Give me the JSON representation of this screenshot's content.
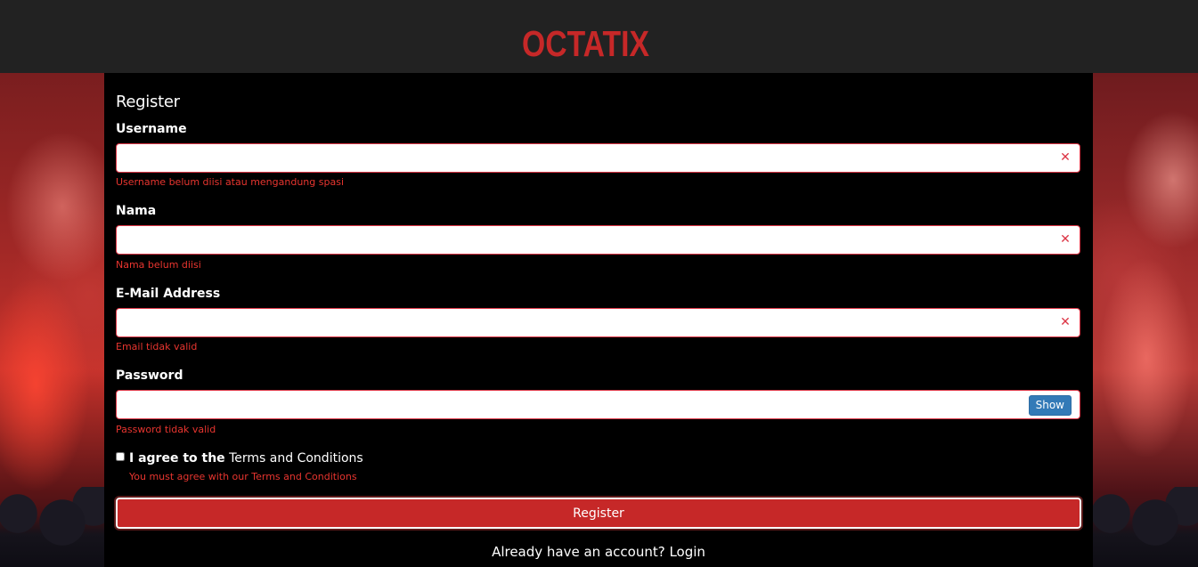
{
  "header": {
    "logo_text": "OCTATIX",
    "logo_color": "#c62828"
  },
  "form": {
    "title": "Register",
    "fields": [
      {
        "label": "Username",
        "value": "",
        "error": "Username belum diisi atau mengandung spasi",
        "icon": "invalid-x-icon"
      },
      {
        "label": "Nama",
        "value": "",
        "error": "Nama belum diisi",
        "icon": "invalid-x-icon"
      },
      {
        "label": "E-Mail Address",
        "value": "",
        "error": "Email tidak valid",
        "icon": "invalid-x-icon"
      },
      {
        "label": "Password",
        "value": "",
        "error": "Password tidak valid",
        "toggle_label": "Show"
      }
    ],
    "agree": {
      "prefix": "I agree to the",
      "link": "Terms and Conditions",
      "checked": false,
      "error": "You must agree with our Terms and Conditions"
    },
    "submit_label": "Register",
    "login_prompt": "Already have an account?",
    "login_link": "Login"
  },
  "colors": {
    "accent": "#c62828",
    "error": "#dc3545",
    "topbar": "#222222",
    "show_button": "#337ab7"
  }
}
